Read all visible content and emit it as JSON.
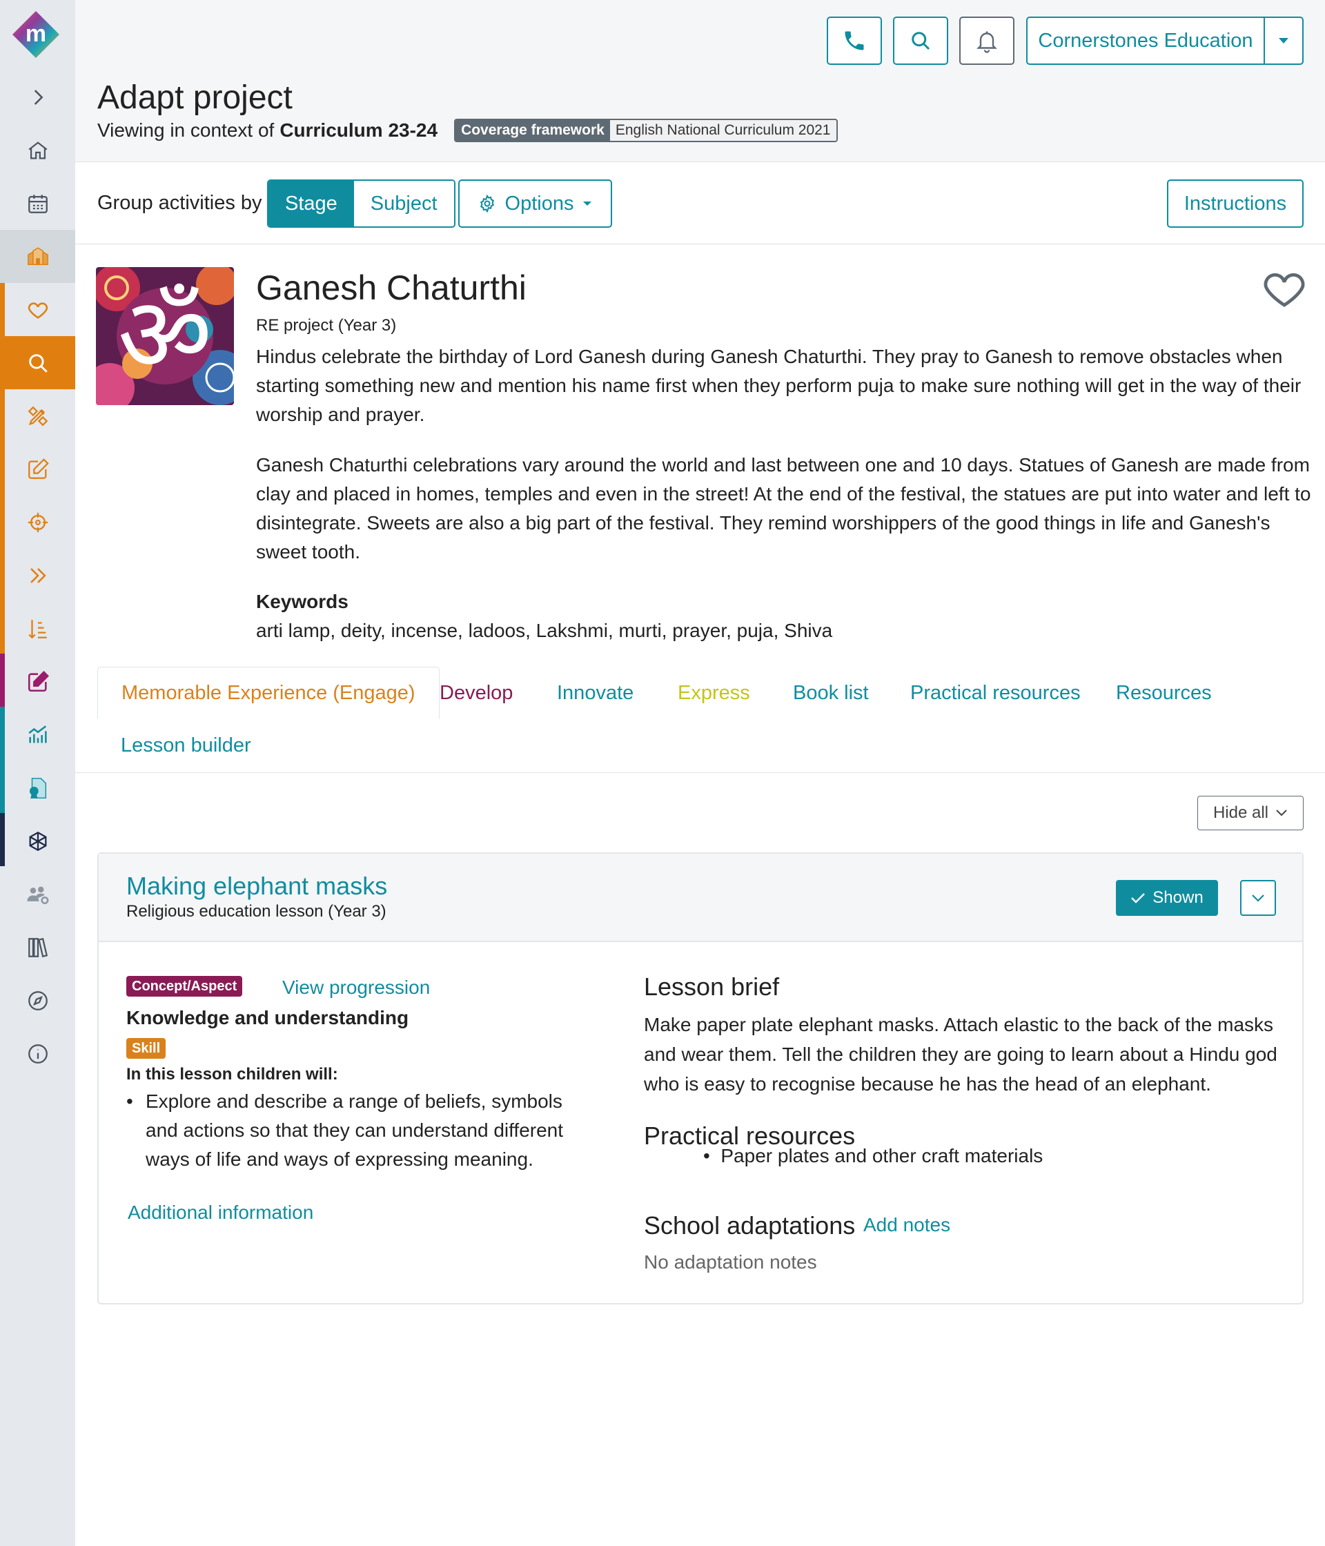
{
  "app": {
    "logo_letter": "m",
    "org_name": "Cornerstones Education"
  },
  "sidebar": {
    "items": [
      {
        "icon": "chevron-right-icon"
      },
      {
        "icon": "home-icon"
      },
      {
        "icon": "calendar-icon"
      },
      {
        "icon": "school-icon"
      },
      {
        "icon": "heart-icon"
      },
      {
        "icon": "search-icon"
      },
      {
        "icon": "design-tools-icon"
      },
      {
        "icon": "edit-icon"
      },
      {
        "icon": "target-icon"
      },
      {
        "icon": "double-chevron-icon"
      },
      {
        "icon": "sort-list-icon"
      },
      {
        "icon": "assessment-edit-icon"
      },
      {
        "icon": "chart-icon"
      },
      {
        "icon": "certificate-icon"
      },
      {
        "icon": "network-icon"
      },
      {
        "icon": "user-settings-icon"
      },
      {
        "icon": "library-icon"
      },
      {
        "icon": "compass-icon"
      },
      {
        "icon": "info-icon"
      }
    ]
  },
  "header": {
    "title": "Adapt project",
    "context_prefix": "Viewing in context of",
    "context_value": "Curriculum 23-24",
    "coverage_label": "Coverage framework",
    "coverage_value": "English National Curriculum 2021"
  },
  "toolbar": {
    "group_label": "Group activities by",
    "group_options": [
      "Stage",
      "Subject"
    ],
    "group_selected": "Stage",
    "options_label": "Options",
    "instructions_label": "Instructions"
  },
  "project": {
    "title": "Ganesh Chaturthi",
    "subtitle": "RE project (Year 3)",
    "description": [
      "Hindus celebrate the birthday of Lord Ganesh during Ganesh Chaturthi. They pray to Ganesh to remove obstacles when starting something new and mention his name first when they perform puja to make sure nothing will get in the way of their worship and prayer.",
      "Ganesh Chaturthi celebrations vary around the world and last between one and 10 days. Statues of Ganesh are made from clay and placed in homes, temples and even in the street! At the end of the festival, the statues are put into water and left to disintegrate. Sweets are also a big part of the festival. They remind worshippers of the good things in life and Ganesh's sweet tooth."
    ],
    "keywords_heading": "Keywords",
    "keywords": "arti lamp, deity, incense, ladoos, Lakshmi, murti, prayer, puja, Shiva"
  },
  "tabs": [
    {
      "label": "Memorable Experience (Engage)",
      "color": "#d9821c",
      "active": true
    },
    {
      "label": "Develop",
      "color": "#8a1b55"
    },
    {
      "label": "Innovate",
      "color": "#0f8d9f"
    },
    {
      "label": "Express",
      "color": "#c4c41a"
    },
    {
      "label": "Book list",
      "color": "#0f8d9f"
    },
    {
      "label": "Practical resources",
      "color": "#0f8d9f"
    },
    {
      "label": "Resources",
      "color": "#0f8d9f"
    },
    {
      "label": "Lesson builder",
      "color": "#0f8d9f"
    }
  ],
  "lesson_controls": {
    "hide_all_label": "Hide all"
  },
  "lesson": {
    "title": "Making elephant masks",
    "subtitle": "Religious education lesson (Year 3)",
    "shown_label": "Shown",
    "concept_badge": "Concept/Aspect",
    "view_progression": "View progression",
    "concept_value": "Knowledge and understanding",
    "skill_badge": "Skill",
    "children_will": "In this lesson children will:",
    "objective": "Explore and describe a range of beliefs, symbols and actions so that they can understand different ways of life and ways of expressing meaning.",
    "additional_info": "Additional information",
    "brief_heading": "Lesson brief",
    "brief_text": "Make paper plate elephant masks. Attach elastic to the back of the masks and wear them. Tell the children they are going to learn about a Hindu god who is easy to recognise because he has the head of an elephant.",
    "practical_heading": "Practical resources",
    "practical_item": "Paper plates and other craft materials",
    "adaptations_heading": "School adaptations",
    "add_notes": "Add notes",
    "no_notes": "No adaptation notes"
  },
  "colors": {
    "accent": "#0f8d9f",
    "sidebar_orange": "#e07f10",
    "concept_badge": "#8a1b55",
    "skill_badge": "#d9821c"
  }
}
